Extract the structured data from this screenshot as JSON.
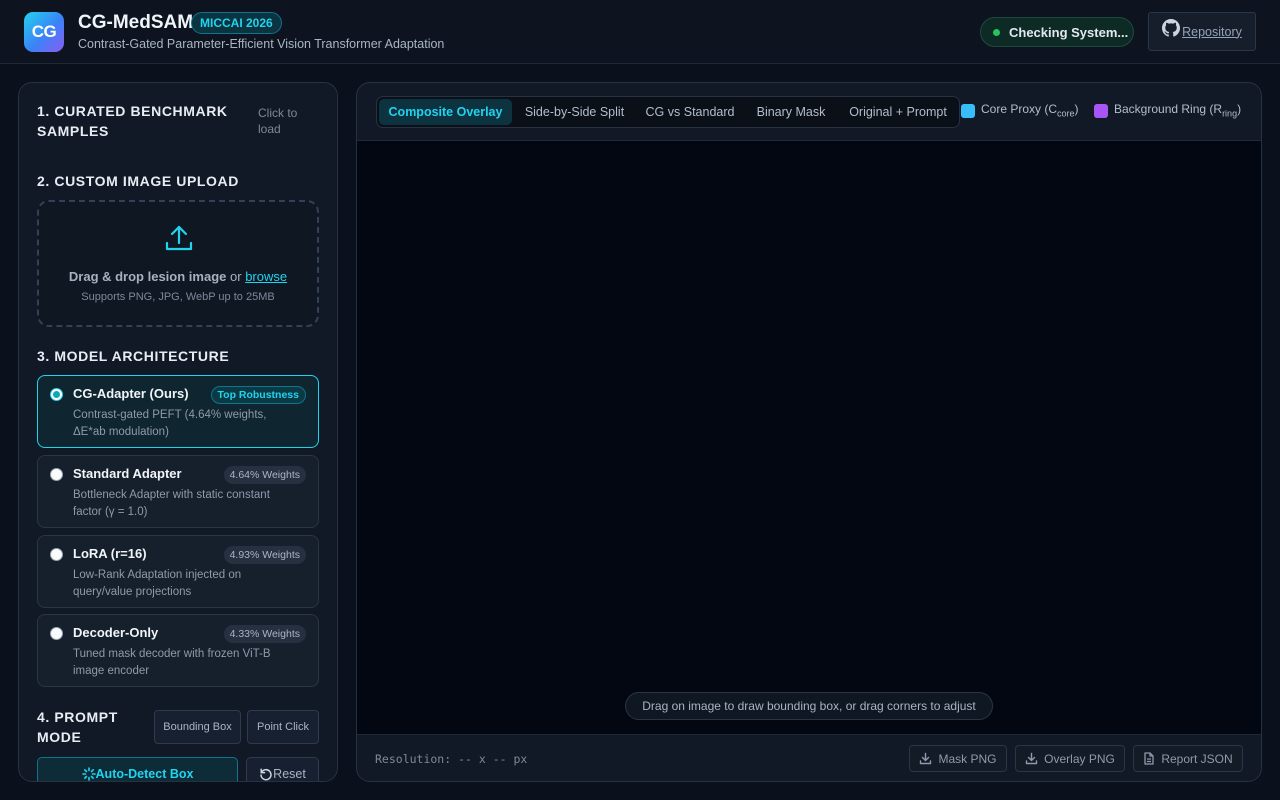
{
  "header": {
    "logo_text": "CG",
    "title": "CG-MedSAM",
    "badge": "MICCAI 2026",
    "subtitle": "Contrast-Gated Parameter-Efficient Vision Transformer Adaptation",
    "status": "Checking System...",
    "repo_label": "Repository",
    "repo_icon": "github-icon"
  },
  "sidebar": {
    "samples": {
      "title": "1. CURATED BENCHMARK SAMPLES",
      "hint": "Click to load"
    },
    "upload": {
      "title": "2. CUSTOM IMAGE UPLOAD",
      "drag_text": "Drag & drop lesion image",
      "or_text": "or",
      "browse": "browse",
      "formats": "Supports PNG, JPG, WebP up to 25MB",
      "icon": "upload-icon"
    },
    "models": {
      "title": "3. MODEL ARCHITECTURE",
      "selected": "CG-Adapter (Ours)",
      "items": [
        {
          "name": "CG-Adapter (Ours)",
          "tag": "Top Robustness",
          "desc": "Contrast-gated PEFT (4.64% weights, ΔE*ab modulation)"
        },
        {
          "name": "Standard Adapter",
          "tag": "4.64% Weights",
          "desc": "Bottleneck Adapter with static constant factor (γ = 1.0)"
        },
        {
          "name": "LoRA (r=16)",
          "tag": "4.93% Weights",
          "desc": "Low-Rank Adaptation injected on query/value projections"
        },
        {
          "name": "Decoder-Only",
          "tag": "4.33% Weights",
          "desc": "Tuned mask decoder with frozen ViT-B image encoder"
        }
      ]
    },
    "prompt": {
      "title": "4. PROMPT MODE",
      "modes": [
        "Bounding Box",
        "Point Click"
      ],
      "auto_detect": "Auto-Detect Box",
      "reset": "Reset"
    }
  },
  "viewer": {
    "tabs": [
      "Composite Overlay",
      "Side-by-Side Split",
      "CG vs Standard",
      "Binary Mask",
      "Original + Prompt"
    ],
    "active_tab": "Composite Overlay",
    "legend": [
      {
        "label": "Core Proxy (C",
        "sub": "core",
        "close": ")",
        "color": "#38bdf8"
      },
      {
        "label": "Background Ring (R",
        "sub": "ring",
        "close": ")",
        "color": "#a855f7"
      }
    ],
    "canvas_hint": "Drag on image to draw bounding box, or drag corners to adjust",
    "resolution": "Resolution: -- x -- px",
    "downloads": [
      "Mask PNG",
      "Overlay PNG",
      "Report JSON"
    ]
  },
  "colors": {
    "accent": "#22d3ee",
    "status_dot": "#22c55e",
    "background": "#0b111c"
  }
}
